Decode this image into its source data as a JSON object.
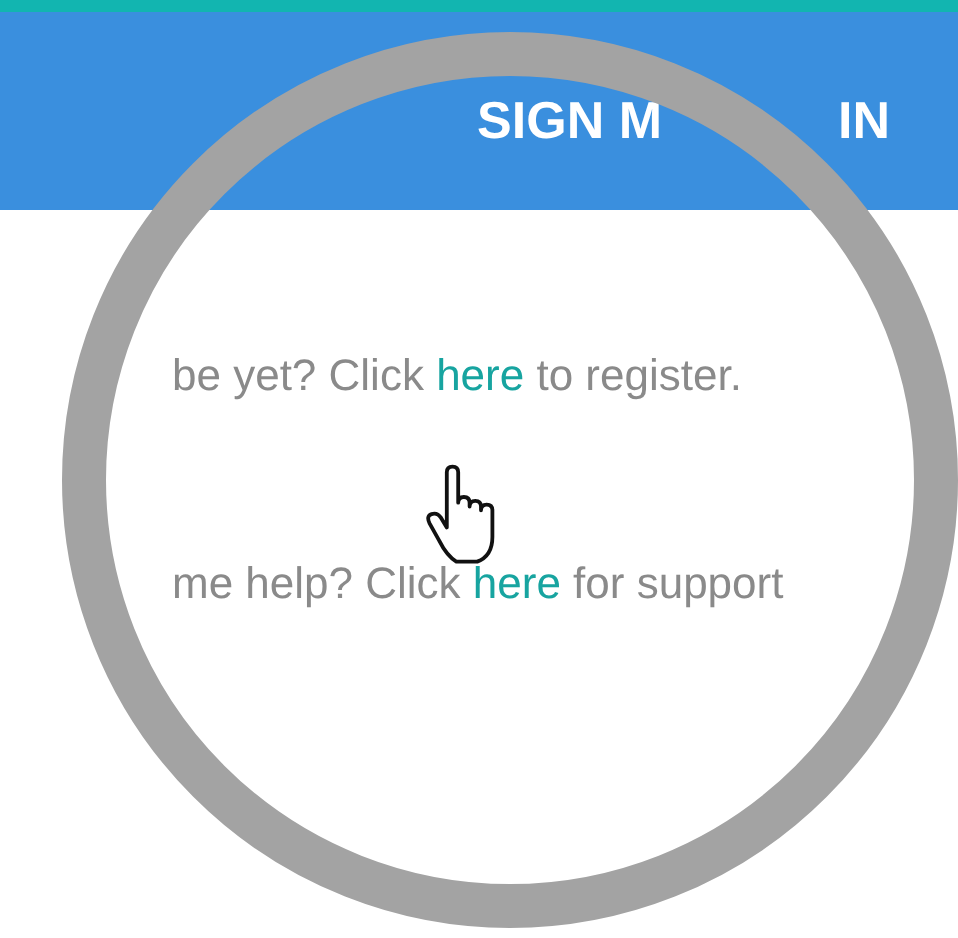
{
  "header": {
    "title_parts": [
      "SIGN M",
      "IN"
    ]
  },
  "lines": [
    {
      "prefix": "be yet? Click ",
      "link": "here",
      "suffix": " to register."
    },
    {
      "prefix": "me help? Click ",
      "link": "here",
      "suffix": " for support"
    }
  ]
}
